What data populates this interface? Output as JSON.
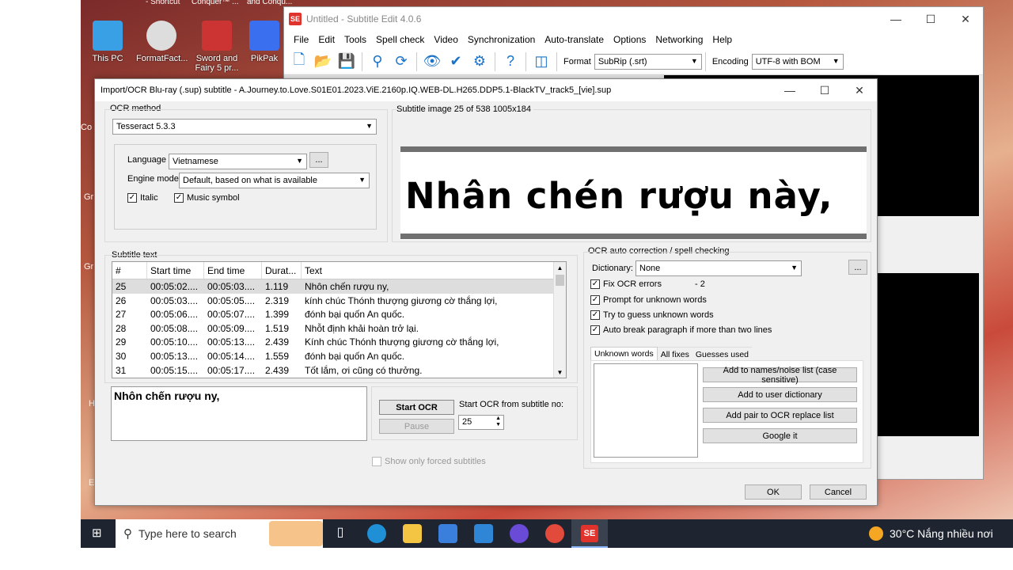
{
  "desktop": {
    "top_labels": [
      "- Shortcut",
      "Conquer™ ...",
      "and Conqu..."
    ],
    "icons": [
      {
        "label": "This PC"
      },
      {
        "label": "FormatFact..."
      },
      {
        "label": "Sword and Fairy 5 pr..."
      },
      {
        "label": "PikPak"
      }
    ],
    "side_fragments": [
      "Co",
      "Gr",
      "Gr",
      "H",
      "E"
    ]
  },
  "main_window": {
    "title": "Untitled - Subtitle Edit 4.0.6",
    "menu": [
      "File",
      "Edit",
      "Tools",
      "Spell check",
      "Video",
      "Synchronization",
      "Auto-translate",
      "Options",
      "Networking",
      "Help"
    ],
    "format_label": "Format",
    "format_value": "SubRip (.srt)",
    "encoding_label": "Encoding",
    "encoding_value": "UTF-8 with BOM"
  },
  "dialog": {
    "title": "Import/OCR Blu-ray (.sup) subtitle - A.Journey.to.Love.S01E01.2023.ViE.2160p.IQ.WEB-DL.H265.DDP5.1-BlackTV_track5_[vie].sup",
    "ocr_method_label": "OCR method",
    "ocr_method_value": "Tesseract 5.3.3",
    "language_label": "Language",
    "language_value": "Vietnamese",
    "more_btn": "...",
    "engine_mode_label": "Engine mode",
    "engine_mode_value": "Default, based on what is available",
    "italic_label": "Italic",
    "music_label": "Music symbol",
    "subtitle_image_label": "Subtitle image 25 of 538   1005x184",
    "subtitle_image_text": "Nhân chén rượu này,",
    "subtitle_text_label": "Subtitle text",
    "columns": [
      "#",
      "Start time",
      "End time",
      "Durat...",
      "Text"
    ],
    "rows": [
      [
        "25",
        "00:05:02....",
        "00:05:03....",
        "1.119",
        "Nhôn chến rượu ny,"
      ],
      [
        "26",
        "00:05:03....",
        "00:05:05....",
        "2.319",
        "kính chúc Thónh thượng giương cờ thắng lợi,"
      ],
      [
        "27",
        "00:05:06....",
        "00:05:07....",
        "1.399",
        "đónh bại quốn An quốc."
      ],
      [
        "28",
        "00:05:08....",
        "00:05:09....",
        "1.519",
        "Nhỗt định khải hoàn trở lại."
      ],
      [
        "29",
        "00:05:10....",
        "00:05:13....",
        "2.439",
        "Kính chúc Thónh thượng giương cờ thắng lợi,"
      ],
      [
        "30",
        "00:05:13....",
        "00:05:14....",
        "1.559",
        "đónh bại quốn An quốc."
      ],
      [
        "31",
        "00:05:15....",
        "00:05:17....",
        "2.439",
        "Tốt lắm, ơi cũng có thưởng."
      ]
    ],
    "current_text": "Nhôn chến rượu ny,",
    "start_ocr": "Start OCR",
    "pause": "Pause",
    "start_from_label": "Start OCR from subtitle no:",
    "start_from_value": "25",
    "forced_label": "Show only forced subtitles",
    "autocorr_label": "OCR auto correction / spell checking",
    "dictionary_label": "Dictionary:",
    "dictionary_value": "None",
    "fix_ocr": "Fix OCR errors",
    "fix_ocr_count": "- 2",
    "prompt_unknown": "Prompt for unknown words",
    "try_guess": "Try to guess unknown words",
    "auto_break": "Auto break paragraph if more than two lines",
    "tabs": [
      "Unknown words",
      "All fixes",
      "Guesses used"
    ],
    "add_names": "Add to names/noise list (case sensitive)",
    "add_dict": "Add to user dictionary",
    "add_pair": "Add pair to OCR replace list",
    "google": "Google it",
    "ok": "OK",
    "cancel": "Cancel"
  },
  "taskbar": {
    "search_placeholder": "Type here to search",
    "weather": "30°C  Nắng nhiều nơi"
  }
}
